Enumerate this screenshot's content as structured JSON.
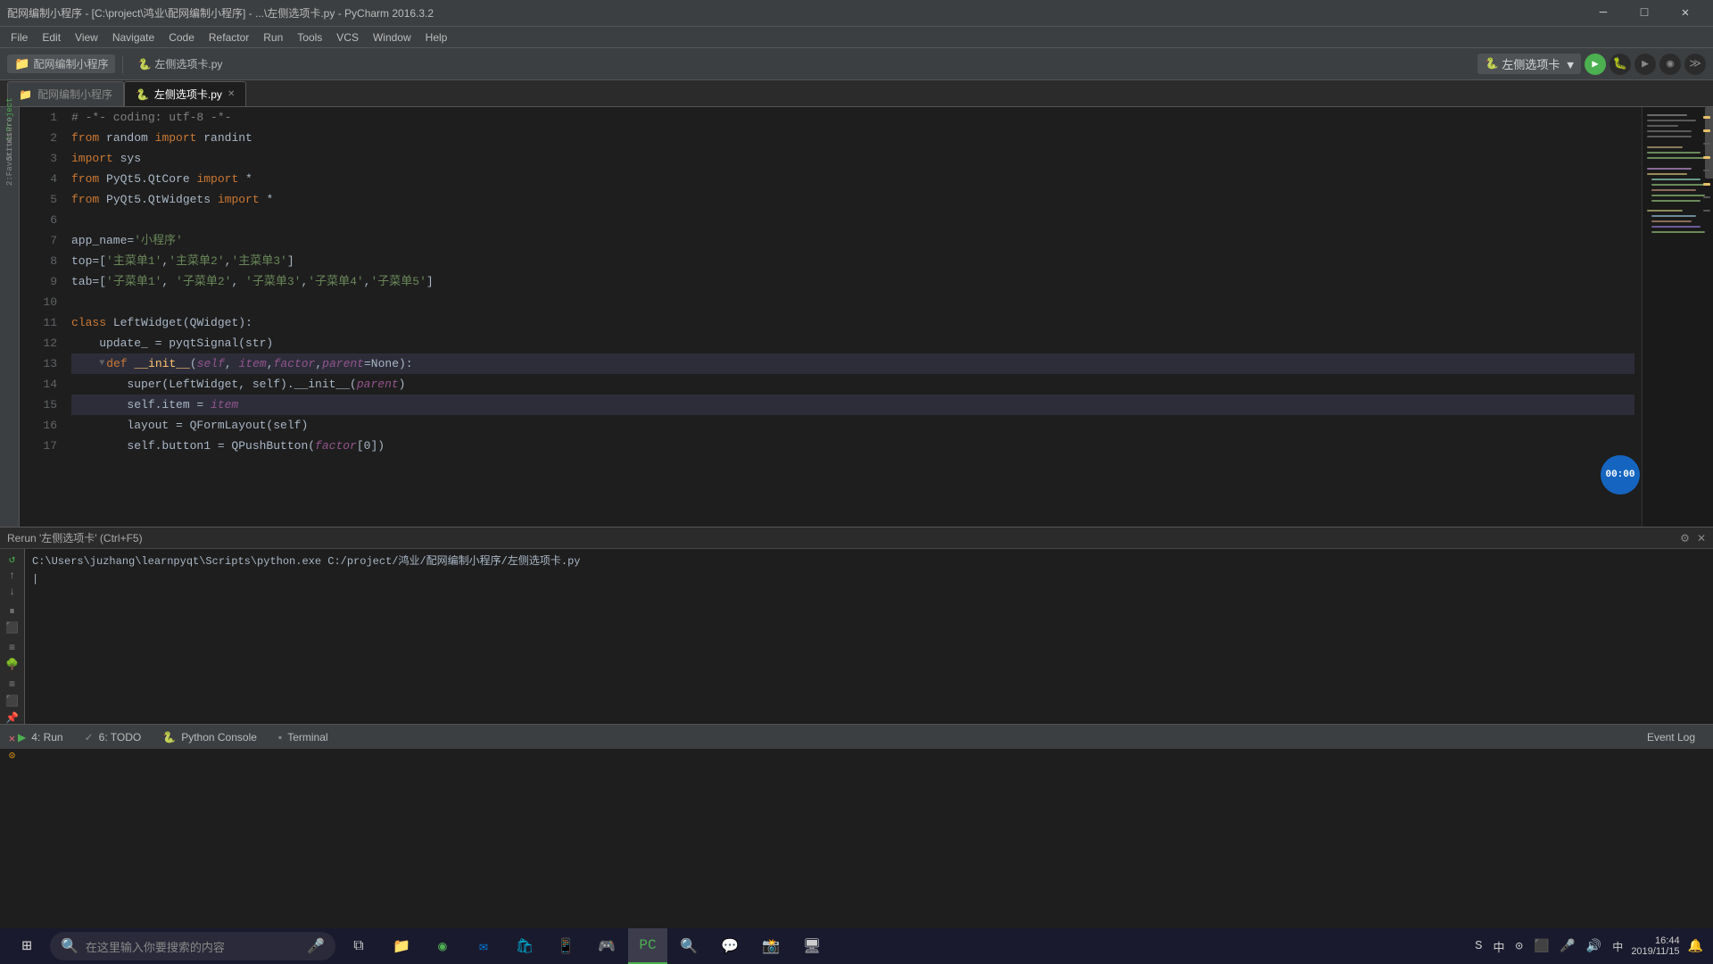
{
  "titleBar": {
    "title": "配网编制小程序 - [C:\\project\\鸿业\\配网编制小程序] - ...\\左侧选项卡.py - PyCharm 2016.3.2",
    "minimize": "─",
    "maximize": "□",
    "close": "✕"
  },
  "menuBar": {
    "items": [
      "File",
      "Edit",
      "View",
      "Navigate",
      "Code",
      "Refactor",
      "Run",
      "Tools",
      "VCS",
      "Window",
      "Help"
    ]
  },
  "toolbar": {
    "projectLabel": "配网编制小程序",
    "fileLabel": "左侧选项卡.py",
    "runConfig": "左侧选项卡 ▼",
    "runBtn": "▶",
    "debugBtn": "🐛",
    "coverBtn": "▶",
    "profileBtn": "◉",
    "moreBtn": "≫"
  },
  "tabs": [
    {
      "label": "左侧选项卡.py",
      "active": true
    },
    {
      "label": "左侧选项卡.py",
      "active": false
    }
  ],
  "code": {
    "lines": [
      {
        "num": 1,
        "content": "# -*- coding: utf-8 -*-",
        "type": "comment"
      },
      {
        "num": 2,
        "content": "from random import randint",
        "type": "import"
      },
      {
        "num": 3,
        "content": "import sys",
        "type": "import"
      },
      {
        "num": 4,
        "content": "from PyQt5.QtCore import *",
        "type": "import"
      },
      {
        "num": 5,
        "content": "from PyQt5.QtWidgets import *",
        "type": "import"
      },
      {
        "num": 6,
        "content": "",
        "type": "blank"
      },
      {
        "num": 7,
        "content": "app_name='小程序'",
        "type": "code"
      },
      {
        "num": 8,
        "content": "top=['主菜单1','主菜单2','主菜单3']",
        "type": "code"
      },
      {
        "num": 9,
        "content": "tab=['子菜单1', '子菜单2', '子菜单3','子菜单4','子菜单5']",
        "type": "code"
      },
      {
        "num": 10,
        "content": "",
        "type": "blank"
      },
      {
        "num": 11,
        "content": "class LeftWidget(QWidget):",
        "type": "class"
      },
      {
        "num": 12,
        "content": "    update_ = pyqtSignal(str)",
        "type": "code"
      },
      {
        "num": 13,
        "content": "    def __init__(self, item,factor,parent=None):",
        "type": "def",
        "highlighted": true
      },
      {
        "num": 14,
        "content": "        super(LeftWidget, self).__init__(parent)",
        "type": "code"
      },
      {
        "num": 15,
        "content": "        self.item = item",
        "type": "code",
        "highlighted": true
      },
      {
        "num": 16,
        "content": "        layout = QFormLayout(self)",
        "type": "code"
      },
      {
        "num": 17,
        "content": "        self.button1 = QPushButton(factor[0])",
        "type": "code"
      }
    ]
  },
  "rerunBar": {
    "label": "Rerun '左侧选项卡' (Ctrl+F5)",
    "settingsIcon": "⚙",
    "closeIcon": "✕"
  },
  "runOutput": {
    "command": "C:\\Users\\juzhang\\learnpyqt\\Scripts\\python.exe C:/project/鸿业/配网编制小程序/左侧选项卡.py"
  },
  "statusTabs": [
    {
      "label": "4: Run",
      "dotColor": "green",
      "icon": "▶"
    },
    {
      "label": "6: TODO",
      "dotColor": null,
      "icon": "✓"
    },
    {
      "label": "Python Console",
      "dotColor": null,
      "icon": "🐍"
    },
    {
      "label": "Terminal",
      "dotColor": null,
      "icon": "▪"
    }
  ],
  "taskbar": {
    "searchPlaceholder": "在这里输入你要搜索的内容",
    "time": "16:44",
    "date": "2019/11/15",
    "startIcon": "⊞"
  },
  "timer": {
    "display": "00:00"
  }
}
